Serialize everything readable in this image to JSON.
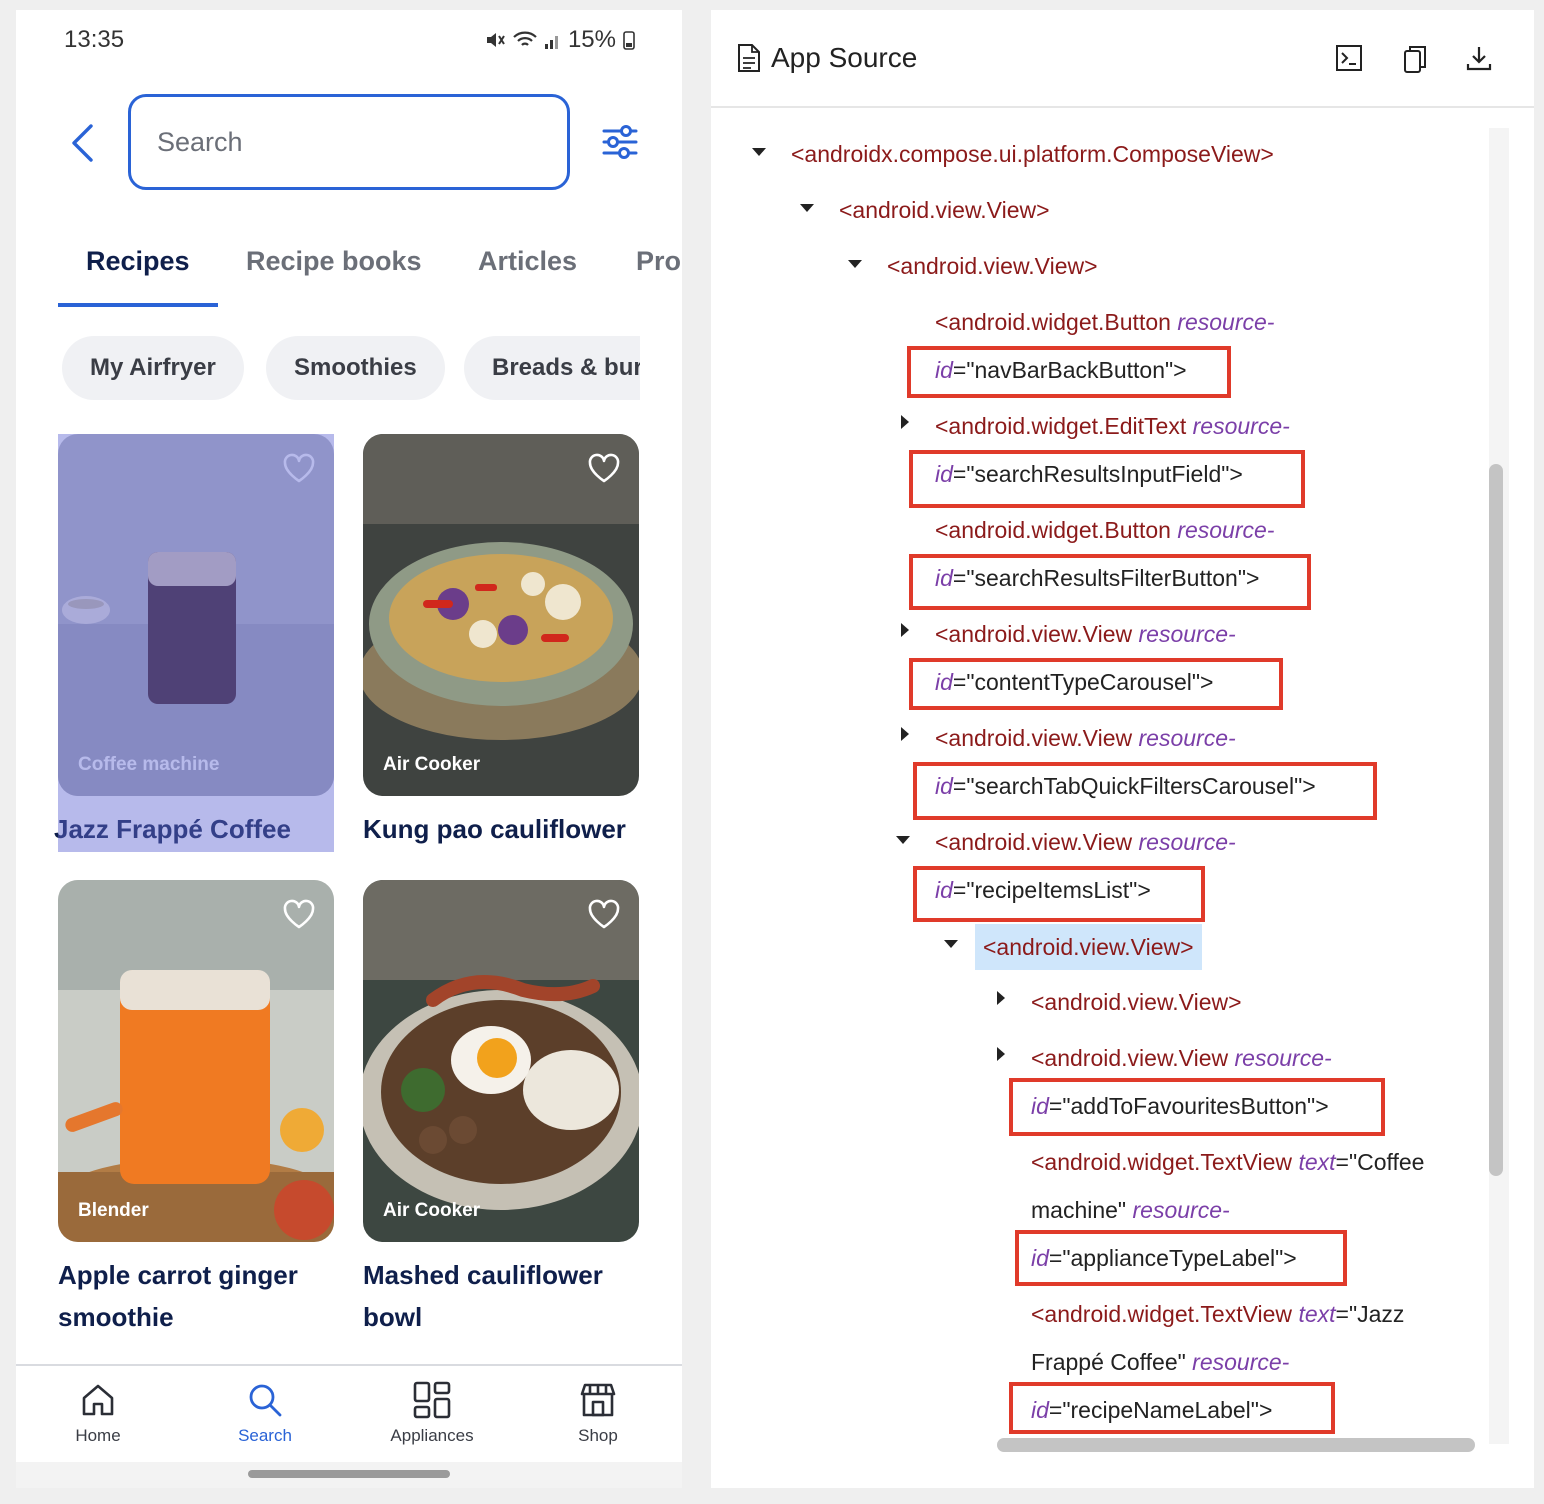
{
  "phone": {
    "status": {
      "time": "13:35",
      "battery": "15%"
    },
    "search": {
      "placeholder": "Search",
      "value": ""
    },
    "tabs": [
      "Recipes",
      "Recipe books",
      "Articles",
      "Pro"
    ],
    "chips": [
      "My Airfryer",
      "Smoothies",
      "Breads & bur"
    ],
    "recipes": [
      {
        "appliance": "Coffee machine",
        "name": "Jazz Frappé Coffee"
      },
      {
        "appliance": "Air Cooker",
        "name": "Kung pao cauliflower"
      },
      {
        "appliance": "Blender",
        "name_line1": "Apple carrot ginger",
        "name_line2": "smoothie"
      },
      {
        "appliance": "Air Cooker",
        "name_line1": "Mashed cauliflower",
        "name_line2": "bowl"
      }
    ],
    "nav": {
      "home": "Home",
      "search": "Search",
      "appliances": "Appliances",
      "shop": "Shop"
    },
    "colors": {
      "accent": "#2a63d6",
      "title": "#0f1f4b",
      "highlight": "#6066d2"
    }
  },
  "source": {
    "title": "App Source",
    "lines": {
      "l1": "<androidx.compose.ui.platform.ComposeView>",
      "l2": "<android.view.View>",
      "l3": "<android.view.View>",
      "l4_tag": "<android.widget.Button",
      "l4_attr": "resource-",
      "l5_attr": "id",
      "l5_val": "=\"navBarBackButton\">",
      "l6_tag": "<android.widget.EditText",
      "l6_attr": "resource-",
      "l7_attr": "id",
      "l7_val": "=\"searchResultsInputField\">",
      "l8_tag": "<android.widget.Button",
      "l8_attr": "resource-",
      "l9_attr": "id",
      "l9_val": "=\"searchResultsFilterButton\">",
      "l10_tag": "<android.view.View",
      "l10_attr": "resource-",
      "l11_attr": "id",
      "l11_val": "=\"contentTypeCarousel\">",
      "l12_tag": "<android.view.View",
      "l12_attr": "resource-",
      "l13_attr": "id",
      "l13_val": "=\"searchTabQuickFiltersCarousel\">",
      "l14_tag": "<android.view.View",
      "l14_attr": "resource-",
      "l15_attr": "id",
      "l15_val": "=\"recipeItemsList\">",
      "l16": "<android.view.View>",
      "l17": "<android.view.View>",
      "l18_tag": "<android.view.View",
      "l18_attr": "resource-",
      "l19_attr": "id",
      "l19_val": "=\"addToFavouritesButton\">",
      "l20_tag": "<android.widget.TextView",
      "l20_attr": "text",
      "l20_val": "=\"Coffee",
      "l21_val": "machine\"",
      "l21_attr": "resource-",
      "l22_attr": "id",
      "l22_val": "=\"applianceTypeLabel\">",
      "l23_tag": "<android.widget.TextView",
      "l23_attr": "text",
      "l23_val": "=\"Jazz",
      "l24_val": "Frappé Coffee\"",
      "l24_attr": "resource-",
      "l25_attr": "id",
      "l25_val": "=\"recipeNameLabel\">"
    },
    "colors": {
      "tag": "#8b1a1a",
      "attr": "#7b3fa8",
      "box": "#e03a2a",
      "selected": "#cfe6fb"
    }
  }
}
